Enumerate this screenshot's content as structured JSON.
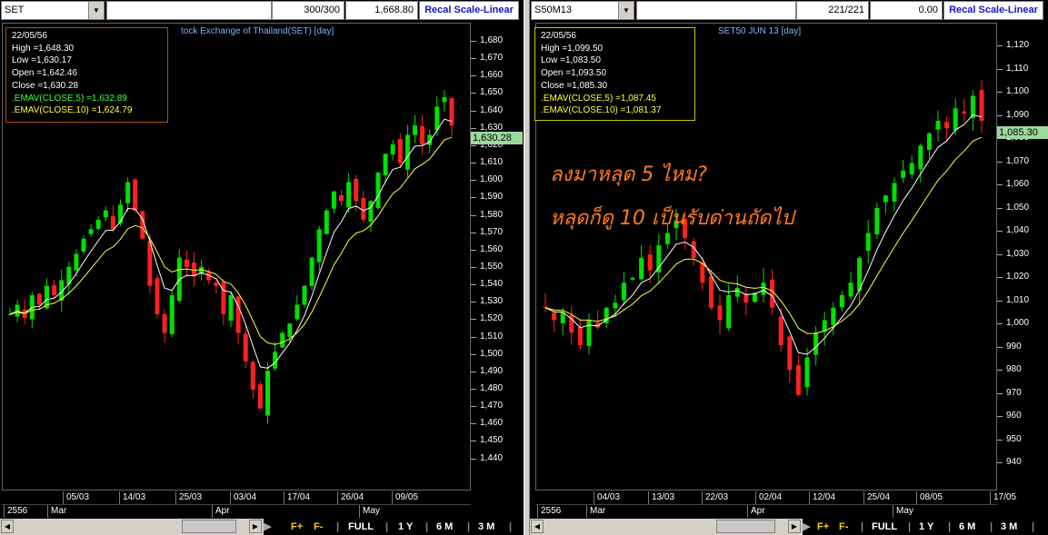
{
  "left": {
    "symbol": "SET",
    "count": "300/300",
    "last_value": "1,668.80",
    "recal_label": "Recal Scale-Linear",
    "title": "tock Exchange of Thailand(SET) [day]",
    "info": {
      "date": "22/05/56",
      "high": "High  =1,648.30",
      "low": "Low   =1,630.17",
      "open": "Open  =1,642.46",
      "close": "Close  =1,630.28",
      "ema5": ".EMAV(CLOSE,5)   =1,632.89",
      "ema10": ".EMAV(CLOSE,10)   =1,624.79"
    },
    "current_label": "1,630.28",
    "y_labels": [
      "1,680",
      "1,670",
      "1,660",
      "1,650",
      "1,640",
      "1,630",
      "1,620",
      "1,610",
      "1,600",
      "1,590",
      "1,580",
      "1,570",
      "1,560",
      "1,550",
      "1,540",
      "1,530",
      "1,520",
      "1,510",
      "1,500",
      "1,490",
      "1,480",
      "1,470",
      "1,460",
      "1,450",
      "1,440"
    ],
    "x_labels": [
      "05/03",
      "14/03",
      "25/03",
      "03/04",
      "17/04",
      "26/04",
      "09/05"
    ],
    "x2_labels": [
      "2556",
      "Mar",
      "Apr",
      "May"
    ]
  },
  "right": {
    "symbol": "S50M13",
    "count": "221/221",
    "last_value": "0.00",
    "recal_label": "Recal Scale-Linear",
    "title": "SET50 JUN 13   [day]",
    "info": {
      "date": "22/05/56",
      "high": "High  =1,099.50",
      "low": "Low   =1,083.50",
      "open": "Open  =1,093.50",
      "close": "Close  =1,085.30",
      "ema5": ".EMAV(CLOSE,5)   =1,087.45",
      "ema10": ".EMAV(CLOSE,10)   =1,081.37"
    },
    "current_label": "1,085.30",
    "y_labels": [
      "1,120",
      "1,110",
      "1,100",
      "1,090",
      "1,080",
      "1,070",
      "1,060",
      "1,050",
      "1,040",
      "1,030",
      "1,020",
      "1,010",
      "1,000",
      "990",
      "980",
      "970",
      "960",
      "950",
      "940"
    ],
    "x_labels": [
      "04/03",
      "13/03",
      "22/03",
      "02/04",
      "12/04",
      "25/04",
      "08/05",
      "17/05"
    ],
    "x2_labels": [
      "2556",
      "Mar",
      "Apr",
      "May"
    ]
  },
  "annotation": {
    "line1": "ลงมาหลุด 5 ไหม?",
    "line2": "หลุดก็ดู 10 เป็นรับด่านถัดไป"
  },
  "bottom_buttons": [
    "F+",
    "F-",
    "FULL",
    "1 Y",
    "6 M",
    "3 M"
  ],
  "colors": {
    "up": "#00e000",
    "down": "#ff2020",
    "ema5": "#ffffff",
    "ema10": "#ffff40",
    "info_border_left": "#b05010",
    "info_border_right": "#c8c800"
  }
}
